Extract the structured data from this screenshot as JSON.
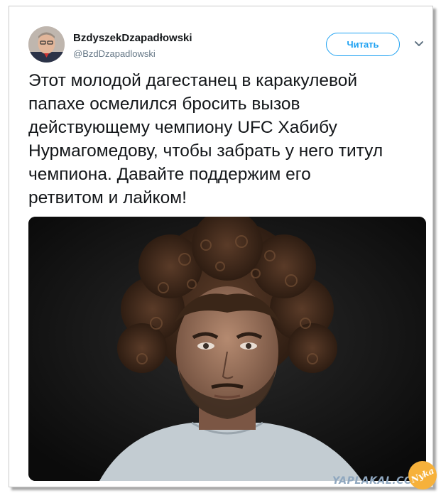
{
  "tweet": {
    "display_name": "BzdyszekDzapadłowski",
    "handle": "@BzdDzapadlowski",
    "follow_label": "Читать",
    "text": "Этот молодой дагестанец в каракулевой\nпапахе осмелился бросить вызов\nдействующему чемпиону UFC Хабибу\nНурмагомедову, чтобы забрать у него титул\nчемпиона. Давайте поддержим его\nретвитом и лайком!",
    "avatar_icon": "avatar-portrait",
    "menu_icon": "chevron-down-icon",
    "media_icon": "photo-portrait-curly-hair"
  },
  "watermark": {
    "text": "YAPLAKAL.COM",
    "badge_text": "Nyka"
  },
  "colors": {
    "accent": "#1da1f2",
    "text": "#14171a",
    "secondary": "#657786"
  }
}
